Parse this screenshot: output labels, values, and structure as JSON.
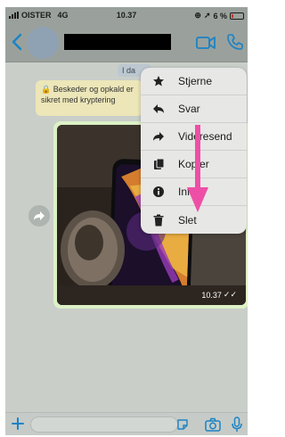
{
  "status_bar": {
    "carrier": "OISTER",
    "network": "4G",
    "time": "10.37",
    "battery": "6 %"
  },
  "chat": {
    "date_chip": "I da",
    "encryption_notice": "Beskeder og opkald er sikret med kryptering",
    "photo_message": {
      "time": "10.37"
    }
  },
  "context_menu": {
    "items": [
      {
        "label": "Stjerne",
        "icon": "star-icon"
      },
      {
        "label": "Svar",
        "icon": "reply-icon"
      },
      {
        "label": "Videresend",
        "icon": "forward-icon"
      },
      {
        "label": "Kopier",
        "icon": "copy-icon"
      },
      {
        "label": "Info",
        "icon": "info-icon"
      },
      {
        "label": "Slet",
        "icon": "trash-icon"
      }
    ]
  },
  "colors": {
    "accent": "#1b83c5",
    "highlight_arrow": "#ee4fa6",
    "outgoing_bubble": "#dcf1c6"
  }
}
